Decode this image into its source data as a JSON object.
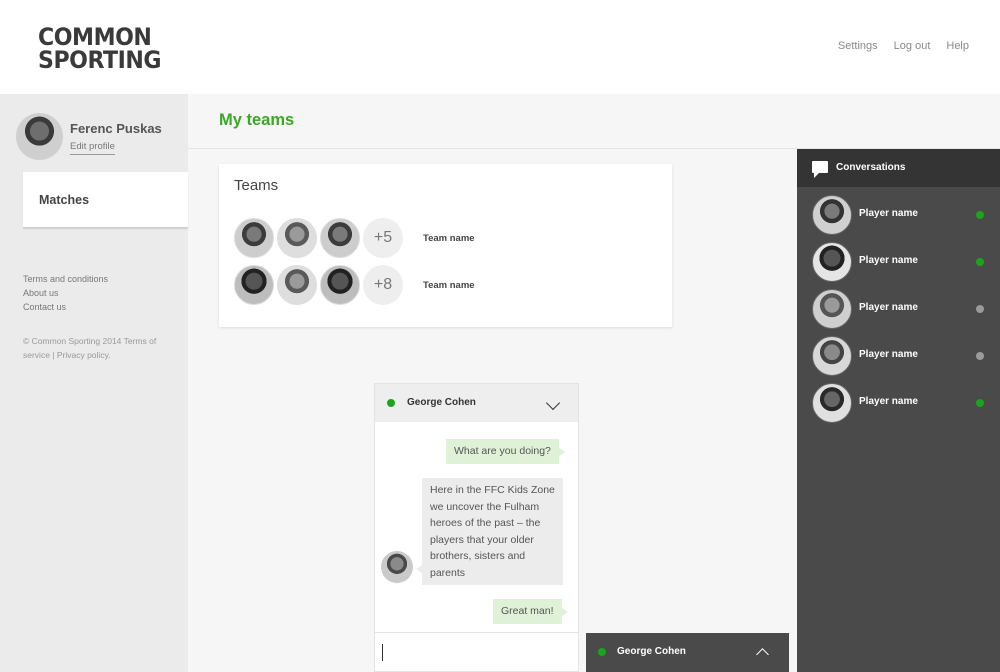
{
  "brand": {
    "line1": "COMMON",
    "line2": "SPORTING"
  },
  "topnav": {
    "settings": "Settings",
    "logout": "Log out",
    "help": "Help"
  },
  "user": {
    "name": "Ferenc Puskas",
    "edit_label": "Edit profile"
  },
  "sidebar": {
    "active_item": "Matches",
    "links": [
      "Terms and conditions",
      "About us",
      "Contact us"
    ],
    "copyright": "© Common Sporting 2014 Terms of service | Privacy policy."
  },
  "page": {
    "title": "My teams"
  },
  "teams": {
    "heading": "Teams",
    "rows": [
      {
        "more": "+5",
        "name": "Team name"
      },
      {
        "more": "+8",
        "name": "Team name"
      }
    ]
  },
  "chat": {
    "contact": "George Cohen",
    "messages": [
      {
        "dir": "out",
        "text": "What are you doing?"
      },
      {
        "dir": "in",
        "text": "Here in the FFC Kids Zone we uncover the Fulham heroes of the past – the players that your older brothers, sisters and parents"
      },
      {
        "dir": "out",
        "text": "Great man!"
      }
    ]
  },
  "mini_chat": {
    "contact": "George Cohen"
  },
  "conversations": {
    "title": "Conversations",
    "items": [
      {
        "name": "Player name",
        "status": "online"
      },
      {
        "name": "Player name",
        "status": "online"
      },
      {
        "name": "Player name",
        "status": "offline"
      },
      {
        "name": "Player name",
        "status": "offline"
      },
      {
        "name": "Player name",
        "status": "online"
      }
    ]
  },
  "colors": {
    "accent": "#3aa826",
    "online": "#1aa51a",
    "offline": "#9a9a9a",
    "panel": "#4a4a4a"
  }
}
